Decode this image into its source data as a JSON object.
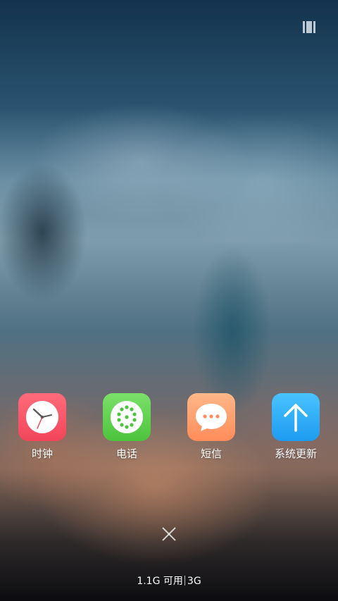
{
  "recents": {
    "apps": [
      {
        "label": "时钟",
        "icon": "clock-icon",
        "color": "#f2455a"
      },
      {
        "label": "电话",
        "icon": "phone-dialpad-icon",
        "color": "#4cc43c"
      },
      {
        "label": "短信",
        "icon": "message-bubble-icon",
        "color": "#ff8c5a"
      },
      {
        "label": "系统更新",
        "icon": "arrow-up-icon",
        "color": "#1d9bf0"
      }
    ]
  },
  "footer": {
    "memory": "1.1G 可用",
    "total": "3G"
  }
}
